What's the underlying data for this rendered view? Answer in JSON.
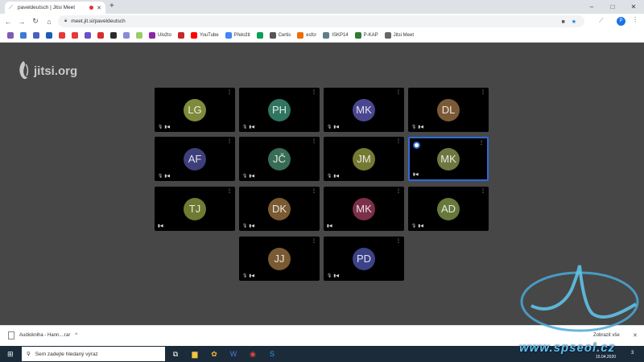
{
  "browser": {
    "tab_title": "paveldeutsch | Jitsi Meet",
    "new_tab": "+",
    "url": "meet.jit.si/paveldeutsch",
    "profile_initial": "P",
    "win_controls": [
      "–",
      "□",
      "✕"
    ]
  },
  "bookmarks": [
    {
      "label": "",
      "color": "#7e5bb5"
    },
    {
      "label": "",
      "color": "#3a7bd5"
    },
    {
      "label": "",
      "color": "#4a5fc1"
    },
    {
      "label": "",
      "color": "#1e5bb8"
    },
    {
      "label": "",
      "color": "#e53935"
    },
    {
      "label": "",
      "color": "#e53935"
    },
    {
      "label": "",
      "color": "#6a4fc9"
    },
    {
      "label": "",
      "color": "#d32f2f"
    },
    {
      "label": "",
      "color": "#2b2b2b"
    },
    {
      "label": "",
      "color": "#8a8ad6"
    },
    {
      "label": "",
      "color": "#9ccc65"
    },
    {
      "label": "Uložto",
      "color": "#8e24aa"
    },
    {
      "label": "",
      "color": "#c62828"
    },
    {
      "label": "YouTube",
      "color": "#ff0000"
    },
    {
      "label": "Přeložit",
      "color": "#4285f4"
    },
    {
      "label": "",
      "color": "#0f9d58"
    },
    {
      "label": "Certis",
      "color": "#555555"
    },
    {
      "label": "esfcr",
      "color": "#ef6c00"
    },
    {
      "label": "ISKP14",
      "color": "#607d8b"
    },
    {
      "label": "P-KAP",
      "color": "#2e7d32"
    },
    {
      "label": "Jitsi Meet",
      "color": "#666666"
    }
  ],
  "logo_text": "jitsi.org",
  "participants": [
    {
      "initials": "LG",
      "color": "#7f8a3a",
      "mic_muted": true,
      "video_off": true
    },
    {
      "initials": "PH",
      "color": "#2f7560",
      "mic_muted": true,
      "video_off": true
    },
    {
      "initials": "MK",
      "color": "#4a4691",
      "mic_muted": true,
      "video_off": true
    },
    {
      "initials": "DL",
      "color": "#7a5a36",
      "mic_muted": true,
      "video_off": true
    },
    {
      "initials": "AF",
      "color": "#3e3f7a",
      "mic_muted": true,
      "video_off": true
    },
    {
      "initials": "JČ",
      "color": "#386c55",
      "mic_muted": true,
      "video_off": true
    },
    {
      "initials": "JM",
      "color": "#757a32",
      "mic_muted": true,
      "video_off": true
    },
    {
      "initials": "MK",
      "color": "#6f7640",
      "mic_muted": false,
      "video_off": true,
      "active": true
    },
    {
      "initials": "TJ",
      "color": "#6f7a33",
      "mic_muted": false,
      "video_off": true
    },
    {
      "initials": "DK",
      "color": "#7a5a32",
      "mic_muted": true,
      "video_off": true
    },
    {
      "initials": "MK",
      "color": "#7b2f49",
      "mic_muted": false,
      "video_off": true
    },
    {
      "initials": "AD",
      "color": "#66783a",
      "mic_muted": true,
      "video_off": true
    },
    {
      "initials": "JJ",
      "color": "#7a5a33",
      "mic_muted": true,
      "video_off": true
    },
    {
      "initials": "PD",
      "color": "#3c4287",
      "mic_muted": true,
      "video_off": true
    }
  ],
  "download_bar": {
    "file_name": "Audiokniha - Hann....rar",
    "show_all": "Zobrazit vše",
    "close": "✕"
  },
  "taskbar": {
    "search_placeholder": "Sem zadejte hledaný výraz",
    "date": "15.04.2020",
    "notification_count": "3"
  },
  "watermark": {
    "url": "www.spseol.cz",
    "brand": "spseol.cz"
  }
}
